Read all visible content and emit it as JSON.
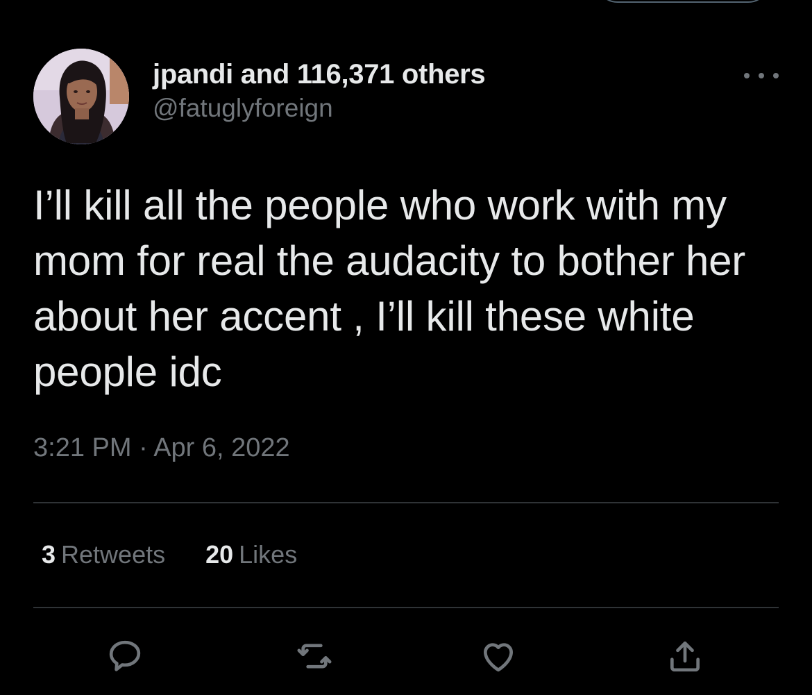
{
  "tweet": {
    "display_name": "jpandi and 116,371 others",
    "handle": "@fatuglyforeign",
    "text": "I’ll kill all the people who work with my mom for real the audacity to bother her about her accent , I’ll kill these white people idc",
    "timestamp": "3:21 PM · Apr 6, 2022"
  },
  "stats": {
    "retweets_count": "3",
    "retweets_label": "Retweets",
    "likes_count": "20",
    "likes_label": "Likes"
  },
  "actions": {
    "reply": "reply-icon",
    "retweet": "retweet-icon",
    "like": "heart-icon",
    "share": "share-icon"
  },
  "colors": {
    "background": "#000000",
    "primary_text": "#e7e9ea",
    "secondary_text": "#71767b",
    "divider": "#2f3336"
  }
}
